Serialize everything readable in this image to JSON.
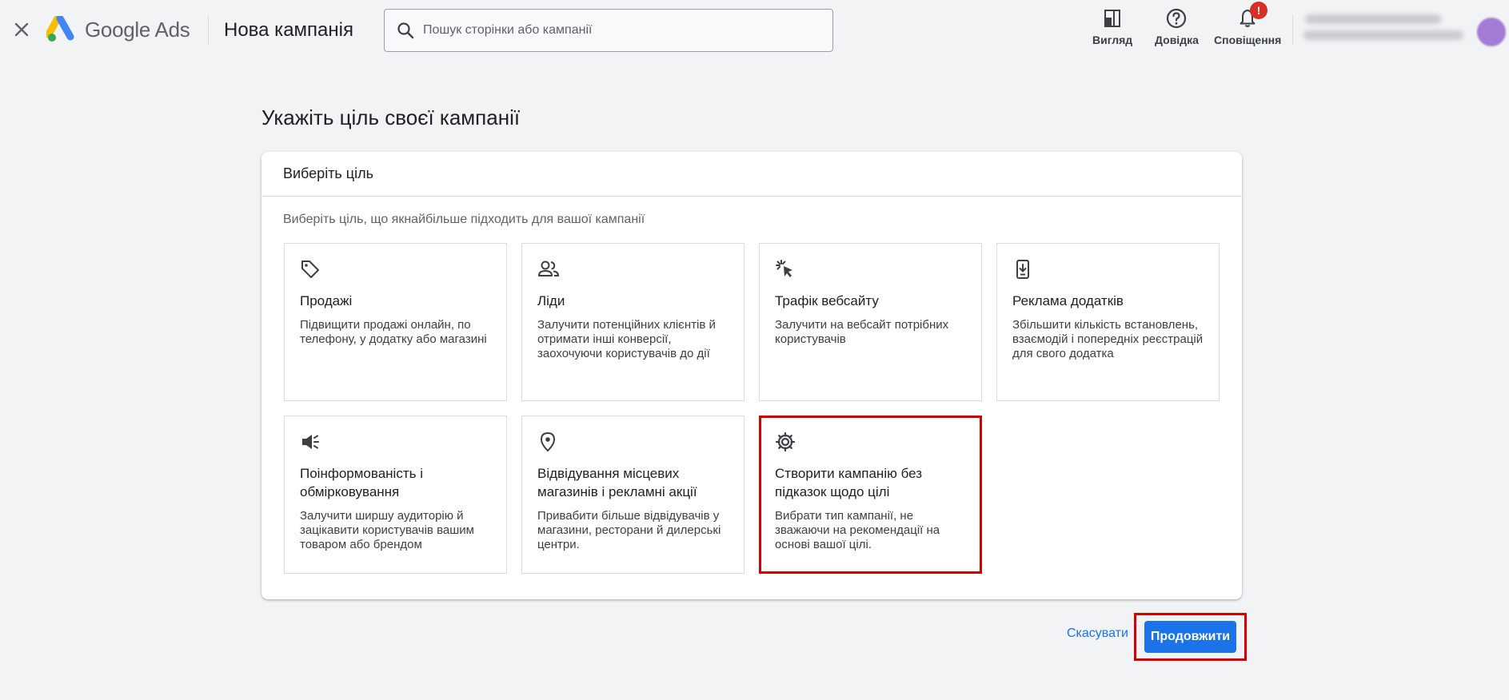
{
  "topbar": {
    "close_icon": "close-icon",
    "brand_name": "Google",
    "brand_product": "Ads",
    "page_title": "Нова кампанія",
    "search_placeholder": "Пошук сторінки або кампанії",
    "search_value": "",
    "tools": [
      {
        "label": "Вигляд",
        "icon": "appearance-icon"
      },
      {
        "label": "Довідка",
        "icon": "help-icon"
      },
      {
        "label": "Сповіщення",
        "icon": "bell-icon",
        "badge": "!"
      }
    ],
    "colors": {
      "badge": "#d93025",
      "accent": "#1a73e8",
      "highlight": "#d50000"
    }
  },
  "main": {
    "heading": "Укажіть ціль своєї кампанії",
    "card_title": "Виберіть ціль",
    "card_subtitle": "Виберіть ціль, що якнайбільше підходить для вашої кампанії",
    "goals": [
      {
        "icon": "tag-icon",
        "title": "Продажі",
        "description": "Підвищити продажі онлайн, по телефону, у додатку або магазині",
        "selected": false
      },
      {
        "icon": "people-icon",
        "title": "Ліди",
        "description": "Залучити потенційних клієнтів й отримати інші конверсії, заохочуючи користувачів до дії",
        "selected": false
      },
      {
        "icon": "cursor-click-icon",
        "title": "Трафік вебсайту",
        "description": "Залучити на вебсайт потрібних користувачів",
        "selected": false
      },
      {
        "icon": "phone-download-icon",
        "title": "Реклама додатків",
        "description": "Збільшити кількість встановлень, взаємодій і попередніх реєстрацій для свого додатка",
        "selected": false
      },
      {
        "icon": "megaphone-icon",
        "title": "Поінформованість і обмірковування",
        "description": "Залучити ширшу аудиторію й зацікавити користувачів вашим товаром або брендом",
        "selected": false
      },
      {
        "icon": "location-pin-icon",
        "title": "Відвідування місцевих магазинів і рекламні акції",
        "description": "Привабити більше відвідувачів у магазини, ресторани й дилерські центри.",
        "selected": false
      },
      {
        "icon": "gear-icon",
        "title": "Створити кампанію без підказок щодо цілі",
        "description": "Вибрати тип кампанії, не зважаючи на рекомендації на основі вашої цілі.",
        "selected": true
      }
    ]
  },
  "footer": {
    "cancel_label": "Скасувати",
    "continue_label": "Продовжити"
  }
}
